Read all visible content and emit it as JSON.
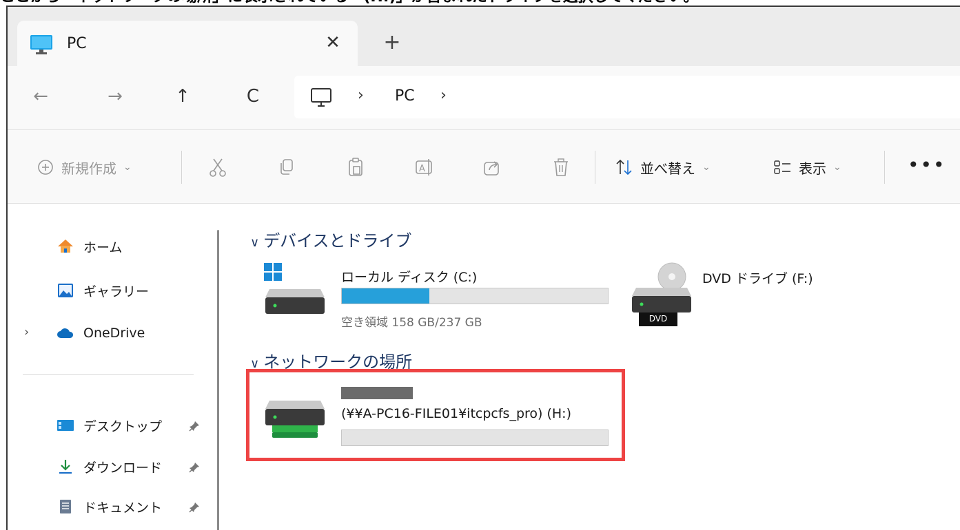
{
  "caption": "ここから「ネットワークの場所」に表示されている「(H:)」が含まれたドライブを選択してください。",
  "tab": {
    "icon": "monitor-icon",
    "title": "PC",
    "close_glyph": "✕",
    "new_tab_glyph": "+"
  },
  "nav_buttons": {
    "back": "←",
    "forward": "→",
    "up": "↑",
    "refresh": "C"
  },
  "address": {
    "icon": "monitor-icon",
    "separator": "›",
    "segment": "PC"
  },
  "commands": {
    "new_label": "新規作成",
    "sort_label": "並べ替え",
    "view_label": "表示",
    "more": "•••"
  },
  "sidebar": {
    "items": [
      {
        "label": "ホーム",
        "icon": "home-icon"
      },
      {
        "label": "ギャラリー",
        "icon": "gallery-icon"
      },
      {
        "label": "OneDrive",
        "icon": "cloud-icon"
      },
      {
        "label": "デスクトップ",
        "icon": "desktop-icon"
      },
      {
        "label": "ダウンロード",
        "icon": "download-icon"
      },
      {
        "label": "ドキュメント",
        "icon": "document-icon"
      }
    ]
  },
  "content": {
    "devices_header": "デバイスとドライブ",
    "network_header": "ネットワークの場所",
    "drives": [
      {
        "name": "ローカル ディスク (C:)",
        "free_text": "空き領域 158 GB/237 GB",
        "used_fraction": 0.33
      },
      {
        "name": "DVD ドライブ (F:)",
        "badge": "DVD"
      }
    ],
    "network_drive": {
      "name": "(¥¥A-PC16-FILE01¥itcpcfs_pro) (H:)",
      "used_fraction": 0.0
    }
  },
  "colors": {
    "accent": "#26a0da",
    "highlight": "#ee4444",
    "header_text": "#1f3864"
  }
}
